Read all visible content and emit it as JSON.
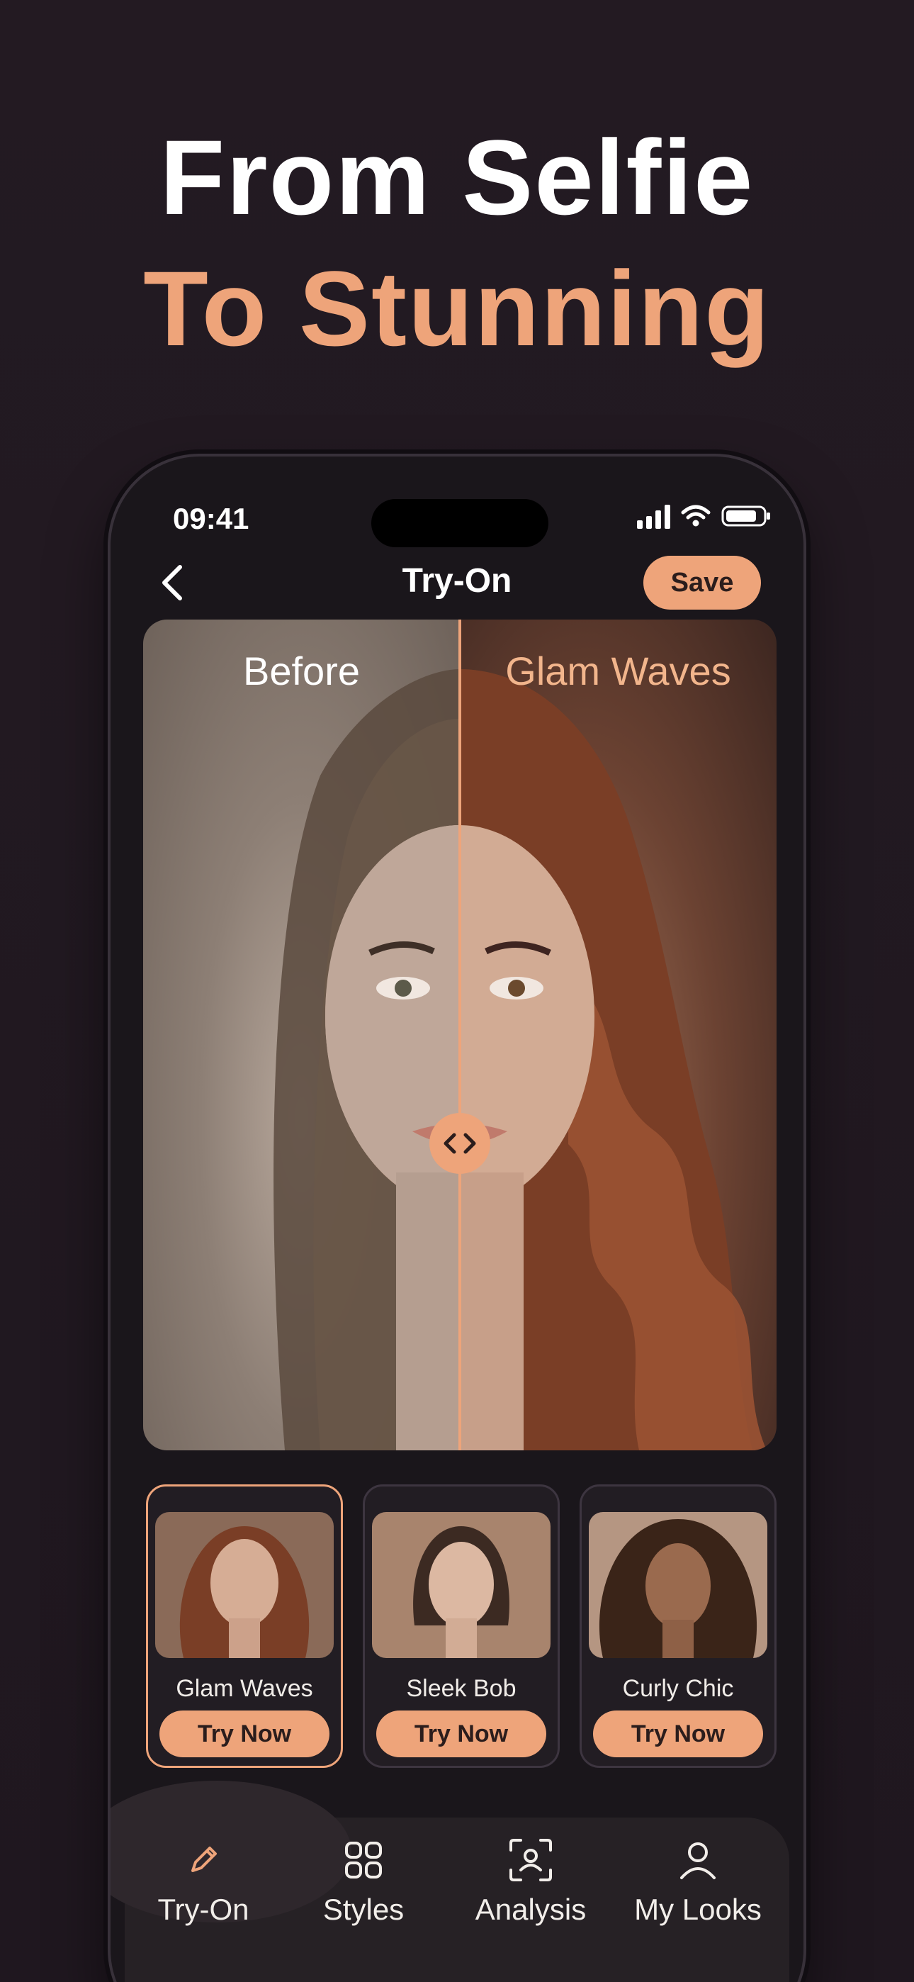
{
  "headline": {
    "line1": "From Selfie",
    "line2": "To Stunning"
  },
  "status": {
    "time": "09:41"
  },
  "nav": {
    "title": "Try-On",
    "save_label": "Save"
  },
  "compare": {
    "before_label": "Before",
    "after_label": "Glam Waves",
    "divider_position": 0.5
  },
  "styles": [
    {
      "name": "Glam Waves",
      "button": "Try Now",
      "selected": true
    },
    {
      "name": "Sleek Bob",
      "button": "Try Now",
      "selected": false
    },
    {
      "name": "Curly Chic",
      "button": "Try Now",
      "selected": false
    }
  ],
  "tabs": [
    {
      "label": "Try-On",
      "icon": "pencil-icon",
      "active": true
    },
    {
      "label": "Styles",
      "icon": "grid-icon",
      "active": false
    },
    {
      "label": "Analysis",
      "icon": "face-scan-icon",
      "active": false
    },
    {
      "label": "My Looks",
      "icon": "person-icon",
      "active": false
    }
  ],
  "colors": {
    "accent": "#eea47a",
    "background": "#211820",
    "surface": "#262125"
  }
}
